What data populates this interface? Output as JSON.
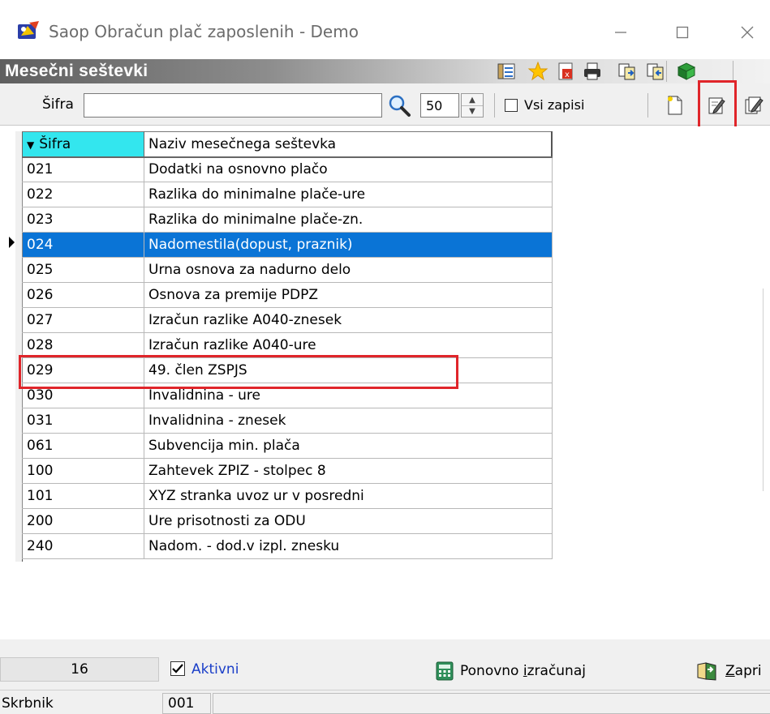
{
  "window": {
    "title": "Saop Obračun plač zaposlenih - Demo",
    "controls": [
      "minimize-icon",
      "maximize-icon",
      "close-icon"
    ]
  },
  "header": {
    "title": "Mesečni seštevki",
    "icons": [
      "columns-icon",
      "favorite-star-icon",
      "export-excel-icon",
      "print-icon",
      "copy-records-icon",
      "import-records-icon",
      "exit-book-icon"
    ]
  },
  "toolbar": {
    "sifra_label": "Šifra",
    "sifra_value": "",
    "count_value": "50",
    "all_records_label": "Vsi zapisi",
    "all_records_checked": false,
    "actions": [
      "new-record-icon",
      "edit-record-icon",
      "edit-multiple-icon"
    ],
    "highlighted_action": "edit-record-icon"
  },
  "grid": {
    "columns": [
      "Šifra",
      "Naziv mesečnega seštevka"
    ],
    "sort_column": "Šifra",
    "rows": [
      {
        "code": "021",
        "name": "Dodatki na osnovno plačo"
      },
      {
        "code": "022",
        "name": "Razlika do minimalne plače-ure"
      },
      {
        "code": "023",
        "name": "Razlika do minimalne plače-zn."
      },
      {
        "code": "024",
        "name": "Nadomestila(dopust, praznik)"
      },
      {
        "code": "025",
        "name": "Urna osnova za nadurno delo"
      },
      {
        "code": "026",
        "name": "Osnova za premije PDPZ"
      },
      {
        "code": "027",
        "name": "Izračun razlike A040-znesek"
      },
      {
        "code": "028",
        "name": "Izračun razlike A040-ure"
      },
      {
        "code": "029",
        "name": "49. člen ZSPJS"
      },
      {
        "code": "030",
        "name": "Invalidnina - ure"
      },
      {
        "code": "031",
        "name": "Invalidnina  - znesek"
      },
      {
        "code": "061",
        "name": "Subvencija min. plača"
      },
      {
        "code": "100",
        "name": "Zahtevek ZPIZ - stolpec 8"
      },
      {
        "code": "101",
        "name": "XYZ stranka uvoz ur v posredni"
      },
      {
        "code": "200",
        "name": "Ure prisotnosti za ODU"
      },
      {
        "code": "240",
        "name": "Nadom. - dod.v izpl. znesku"
      }
    ],
    "selected_code": "024"
  },
  "footer": {
    "record_count": "16",
    "active_label": "Aktivni",
    "active_checked": true,
    "recalc_prefix": "Ponovno ",
    "recalc_accel": "i",
    "recalc_suffix": "zračunaj",
    "close_accel": "Z",
    "close_suffix": "apri"
  },
  "status": {
    "label": "Skrbnik",
    "value": "001"
  },
  "colors": {
    "selection": "#0a74d6",
    "sort_header": "#33e6ee",
    "highlight_box": "#e0252a"
  }
}
